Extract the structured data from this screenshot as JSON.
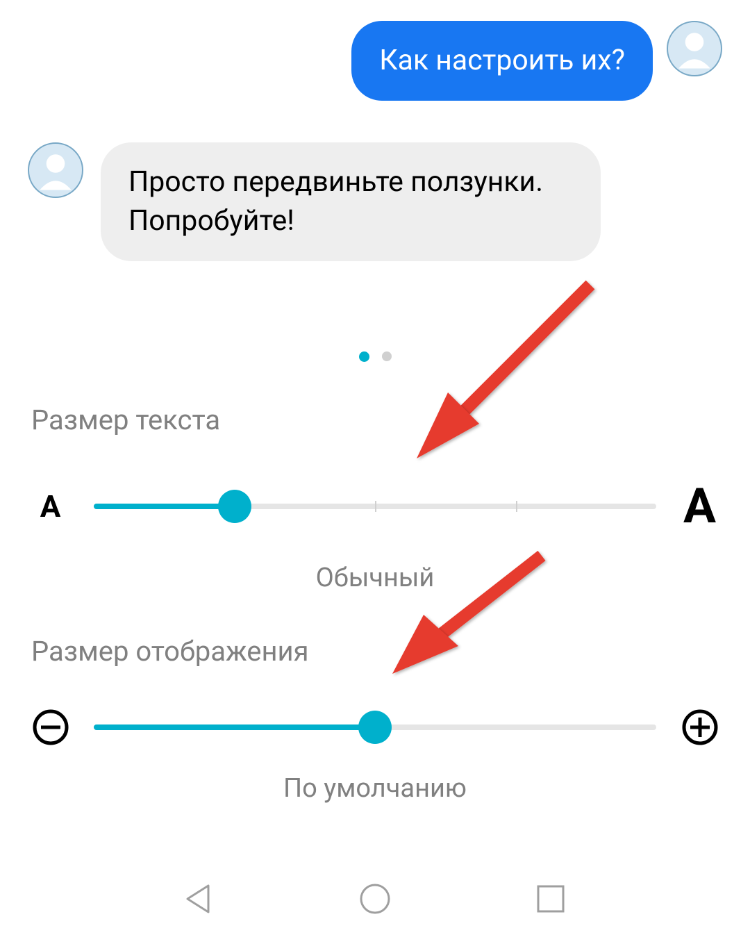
{
  "chat": {
    "outgoing": "Как настроить их?",
    "incoming": "Просто передвиньте ползунки. Попробуйте!"
  },
  "pager": {
    "count": 2,
    "active": 0
  },
  "text_size": {
    "title": "Размер текста",
    "caption": "Обычный",
    "small_cap": "A",
    "big_cap": "A",
    "value_percent": 25,
    "ticks_percent": [
      50,
      75
    ]
  },
  "display_size": {
    "title": "Размер отображения",
    "caption": "По умолчанию",
    "value_percent": 50
  },
  "icons": {
    "minus": "minus-circle",
    "plus": "plus-circle"
  },
  "nav": {
    "back": "back",
    "home": "home",
    "recents": "recents"
  }
}
